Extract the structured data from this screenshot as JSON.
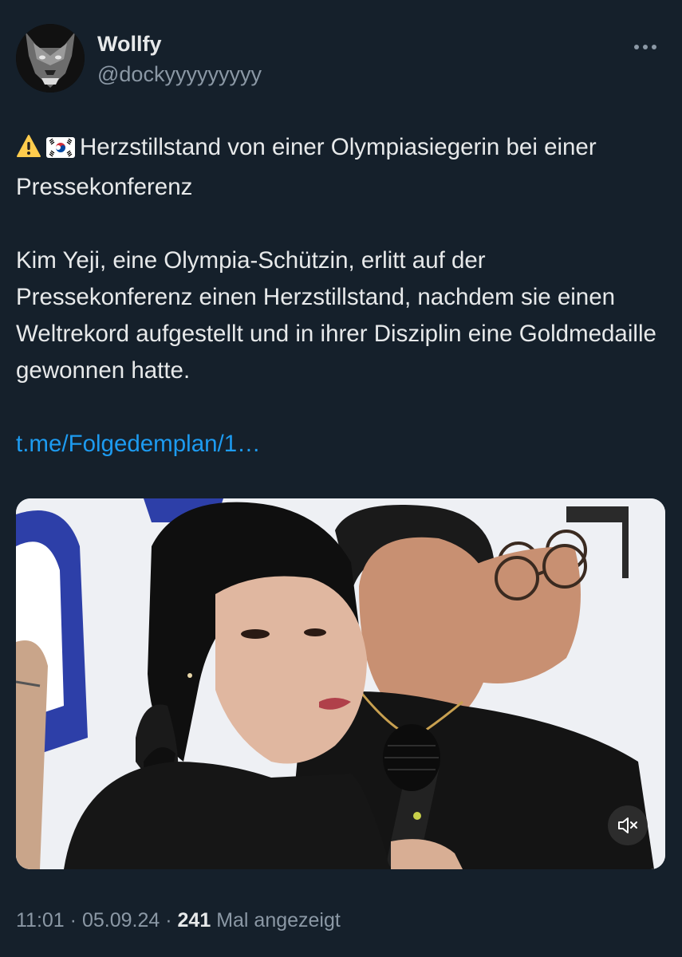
{
  "author": {
    "display_name": "Wollfy",
    "handle": "@dockyyyyyyyyy",
    "avatar_icon": "wolf-avatar"
  },
  "tweet": {
    "headline_emojis": [
      "warning-icon",
      "south-korea-flag-icon"
    ],
    "headline": "Herzstillstand von einer Olympiasiegerin bei einer Pressekonferenz",
    "body": "Kim Yeji, eine Olympia-Schützin, erlitt auf der Pressekonferenz einen Herzstillstand, nachdem sie einen Weltrekord aufgestellt und in ihrer Disziplin eine Goldmedaille gewonnen hatte.",
    "link_text": "t.me/Folgedemplan/1…"
  },
  "media": {
    "type": "video",
    "mute_icon": "speaker-muted-icon"
  },
  "meta": {
    "time": "11:01",
    "separator": "·",
    "date": "05.09.24",
    "views_count": "241",
    "views_label": "Mal angezeigt"
  },
  "colors": {
    "background": "#15202b",
    "text_primary": "#e7e9ea",
    "text_secondary": "#8b98a5",
    "link": "#1d9bf0"
  }
}
